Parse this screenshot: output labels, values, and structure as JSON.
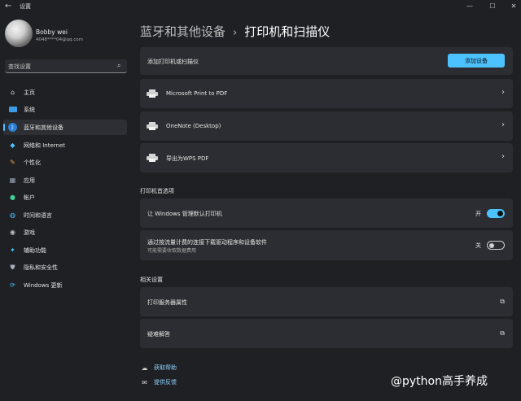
{
  "window": {
    "title": "设置",
    "back_icon": "back-arrow-icon",
    "min_icon": "minimize-icon",
    "max_icon": "maximize-icon",
    "close_icon": "close-icon"
  },
  "profile": {
    "name": "Bobby wei",
    "email": "4048****04@qq.com"
  },
  "search": {
    "placeholder": "查找设置",
    "icon": "search-icon"
  },
  "sidebar": {
    "items": [
      {
        "label": "主页",
        "icon": "home-icon"
      },
      {
        "label": "系统",
        "icon": "system-icon"
      },
      {
        "label": "蓝牙和其他设备",
        "icon": "bluetooth-icon",
        "active": true
      },
      {
        "label": "网络和 Internet",
        "icon": "wifi-icon"
      },
      {
        "label": "个性化",
        "icon": "brush-icon"
      },
      {
        "label": "应用",
        "icon": "apps-icon"
      },
      {
        "label": "帐户",
        "icon": "account-icon"
      },
      {
        "label": "时间和语言",
        "icon": "globe-clock-icon"
      },
      {
        "label": "游戏",
        "icon": "gamepad-icon"
      },
      {
        "label": "辅助功能",
        "icon": "accessibility-icon"
      },
      {
        "label": "隐私和安全性",
        "icon": "shield-icon"
      },
      {
        "label": "Windows 更新",
        "icon": "update-icon"
      }
    ]
  },
  "breadcrumb": {
    "parent": "蓝牙和其他设备",
    "separator": "›",
    "current": "打印机和扫描仪"
  },
  "add_printer": {
    "label": "添加打印机或扫描仪",
    "button": "添加设备"
  },
  "printers": [
    {
      "name": "Microsoft Print to PDF",
      "icon": "printer-icon"
    },
    {
      "name": "OneNote (Desktop)",
      "icon": "printer-icon"
    },
    {
      "name": "导出为WPS PDF",
      "icon": "printer-icon"
    }
  ],
  "preferences": {
    "title": "打印机首选项",
    "manage_default": {
      "label": "让 Windows 管理默认打印机",
      "state_text": "开",
      "on": true
    },
    "metered": {
      "label": "通过按流量计费的连接下载驱动程序和设备软件",
      "sublabel": "可能需要收取数据费用",
      "state_text": "关",
      "on": false
    }
  },
  "related": {
    "title": "相关设置",
    "items": [
      {
        "label": "打印服务器属性",
        "icon": "external-link-icon"
      },
      {
        "label": "疑难解答",
        "icon": "external-link-icon"
      }
    ]
  },
  "help": {
    "get_help": {
      "label": "获取帮助",
      "icon": "help-chat-icon"
    },
    "feedback": {
      "label": "提供反馈",
      "icon": "feedback-icon"
    }
  },
  "watermark": "@python高手养成",
  "colors": {
    "accent": "#4cc2ff",
    "background": "#1f2024",
    "card": "#2c2d32"
  }
}
